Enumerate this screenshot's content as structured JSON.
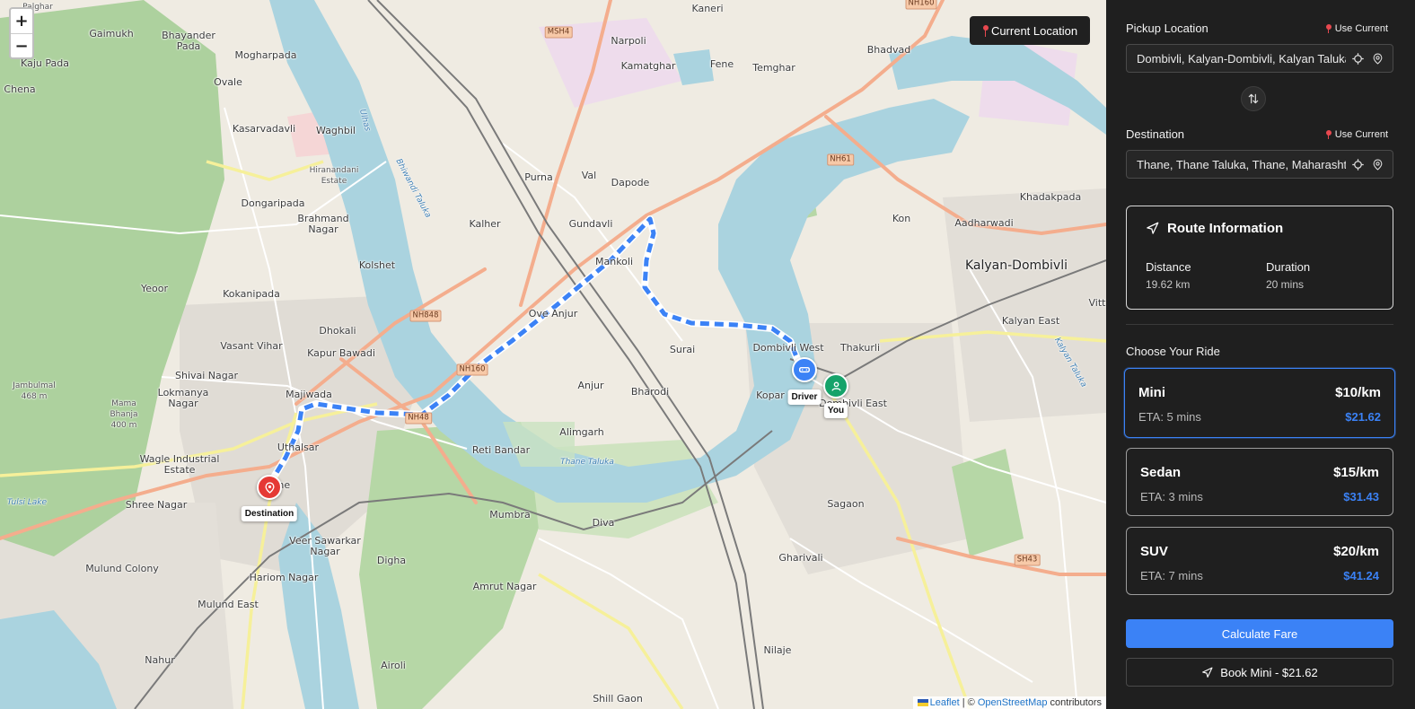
{
  "map": {
    "zoom_in": "+",
    "zoom_out": "−",
    "current_location_button": "Current Location",
    "markers": {
      "driver": "Driver",
      "you": "You",
      "destination": "Destination"
    },
    "attribution": {
      "leaflet": "Leaflet",
      "separator": " | © ",
      "osm": "OpenStreetMap",
      "suffix": " contributors"
    },
    "places": [
      "Palghar",
      "Gaimukh",
      "Bhayander Pada",
      "Kaju Pada",
      "Chena",
      "Mogharpada",
      "Ovale",
      "Kasarvadavli",
      "Waghbil",
      "Hiranandani Estate",
      "Dongaripada",
      "Brahmand Nagar",
      "Kolshet",
      "Yeoor",
      "Kokanipada",
      "Dhokali",
      "Vasant Vihar",
      "Kapur Bawadi",
      "Shivai Nagar",
      "Lokmanya Nagar",
      "Majiwada",
      "Jambulmal 468 m",
      "Mama Bhanja 400 m",
      "Wagle Industrial Estate",
      "Uthalsar",
      "Thane",
      "Shree Nagar",
      "Tulsi Lake",
      "Veer Sawarkar Nagar",
      "Mulund Colony",
      "Hariom Nagar",
      "Mulund East",
      "Nahur",
      "Digha",
      "Airoli",
      "Amrut Nagar",
      "Mumbra",
      "Reti Bandar",
      "Alimgarh",
      "Anjur",
      "Bharodi",
      "Diva",
      "Shill Gaon",
      "Kaneri",
      "Narpoli",
      "Kamatghar",
      "Fene",
      "Temghar",
      "Bhadvad",
      "Purna",
      "Val",
      "Dapode",
      "Kalher",
      "Gundavli",
      "Mankoli",
      "Ove Anjur",
      "Surai",
      "Dombivli West",
      "Thakurli",
      "Kopar",
      "Dombivli East",
      "Sagaon",
      "Gharivali",
      "Nilaje",
      "Kon",
      "Aadharwadi",
      "Kalyan-Dombivli",
      "Khadakpada",
      "Kalyan East",
      "Vitt"
    ],
    "road_labels": [
      "NH160",
      "MSH4",
      "NH61",
      "NH848",
      "NH160",
      "NH48",
      "SH43"
    ],
    "water_labels": [
      "Ulhas",
      "Bhiwandi Taluka",
      "Thane Taluka",
      "Kalyan Taluka"
    ]
  },
  "panel": {
    "pickup": {
      "label": "Pickup Location",
      "use_current": "Use Current",
      "value": "Dombivli, Kalyan-Dombivli, Kalyan Taluka, Thane, Maharashtra"
    },
    "destination": {
      "label": "Destination",
      "use_current": "Use Current",
      "value": "Thane, Thane Taluka, Thane, Maharashtra, India"
    },
    "route": {
      "title": "Route Information",
      "distance_label": "Distance",
      "distance_value": "19.62 km",
      "duration_label": "Duration",
      "duration_value": "20 mins"
    },
    "choose_title": "Choose Your Ride",
    "rides": [
      {
        "name": "Mini",
        "rate": "$10/km",
        "eta": "ETA: 5 mins",
        "price": "$21.62",
        "selected": true
      },
      {
        "name": "Sedan",
        "rate": "$15/km",
        "eta": "ETA: 3 mins",
        "price": "$31.43",
        "selected": false
      },
      {
        "name": "SUV",
        "rate": "$20/km",
        "eta": "ETA: 7 mins",
        "price": "$41.24",
        "selected": false
      }
    ],
    "calculate_button": "Calculate Fare",
    "book_button": "Book Mini - $21.62"
  },
  "colors": {
    "panel_bg": "#1f1f1f",
    "accent": "#3b82f6",
    "driver_marker": "#3b82f6",
    "you_marker": "#16a36a",
    "destination_marker": "#e53935",
    "water": "#aad3df",
    "forest": "#add19e",
    "motorway": "#e892a2"
  },
  "icons": [
    "plus-icon",
    "minus-icon",
    "pin-icon",
    "crosshair-icon",
    "map-pin-icon",
    "swap-icon",
    "navigation-icon",
    "car-icon",
    "user-icon"
  ]
}
